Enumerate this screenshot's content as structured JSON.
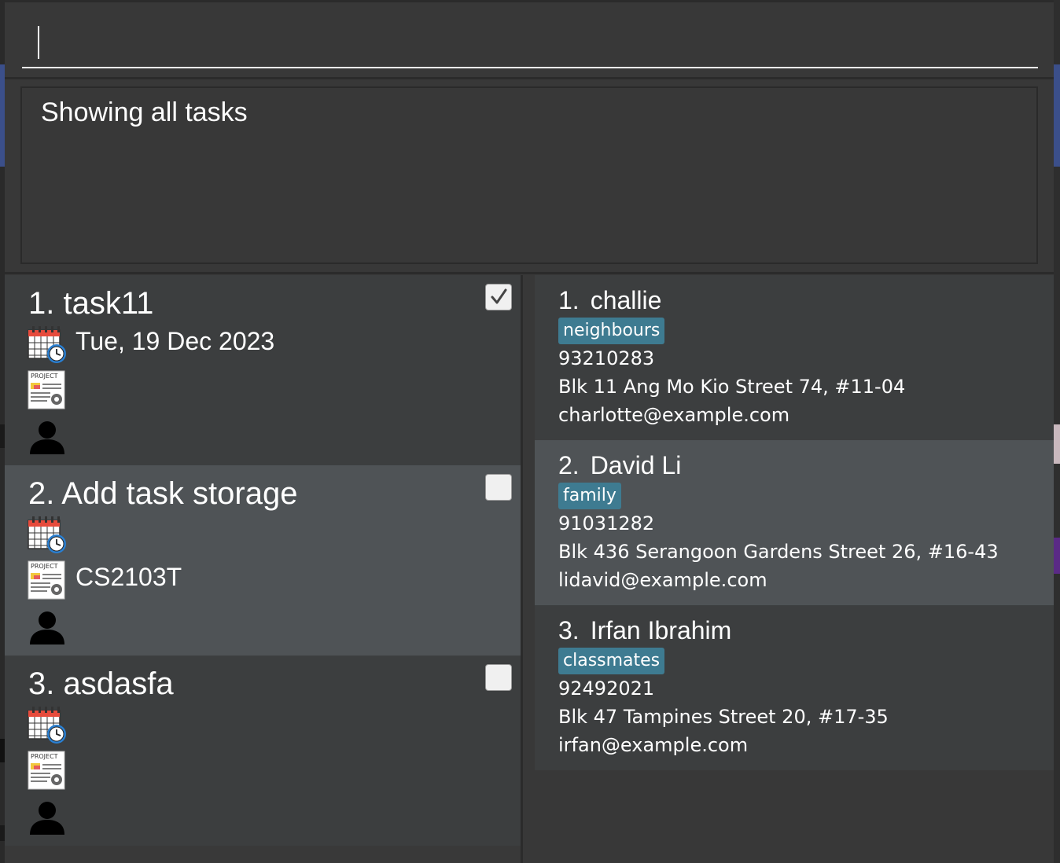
{
  "command_box": {
    "value": "",
    "placeholder": ""
  },
  "result_display": {
    "text": "Showing all tasks"
  },
  "tasks": [
    {
      "title": "1. task11",
      "done": true,
      "date": "Tue, 19 Dec 2023",
      "project": "",
      "assignee": ""
    },
    {
      "title": "2. Add task storage",
      "done": false,
      "date": "",
      "project": "CS2103T",
      "assignee": ""
    },
    {
      "title": "3. asdasfa",
      "done": false,
      "date": "",
      "project": "",
      "assignee": ""
    }
  ],
  "persons": [
    {
      "index": "1.",
      "name": "challie",
      "tag": "neighbours",
      "phone": "93210283",
      "address": "Blk 11 Ang Mo Kio Street 74, #11-04",
      "email": "charlotte@example.com"
    },
    {
      "index": "2.",
      "name": "David Li",
      "tag": "family",
      "phone": "91031282",
      "address": "Blk 436 Serangoon Gardens Street 26, #16-43",
      "email": "lidavid@example.com"
    },
    {
      "index": "3.",
      "name": "Irfan Ibrahim",
      "tag": "classmates",
      "phone": "92492021",
      "address": "Blk 47 Tampines Street 20, #17-35",
      "email": "irfan@example.com"
    }
  ],
  "icons": {
    "deadline": "calendar-clock-icon",
    "project": "project-document-icon",
    "assignee": "person-icon",
    "checkbox": "checkbox-icon"
  },
  "colors": {
    "background": "#383838",
    "card_odd": "#3c3e3f",
    "card_even": "#4f5356",
    "tag": "#3e7b91",
    "text": "#ffffff"
  }
}
